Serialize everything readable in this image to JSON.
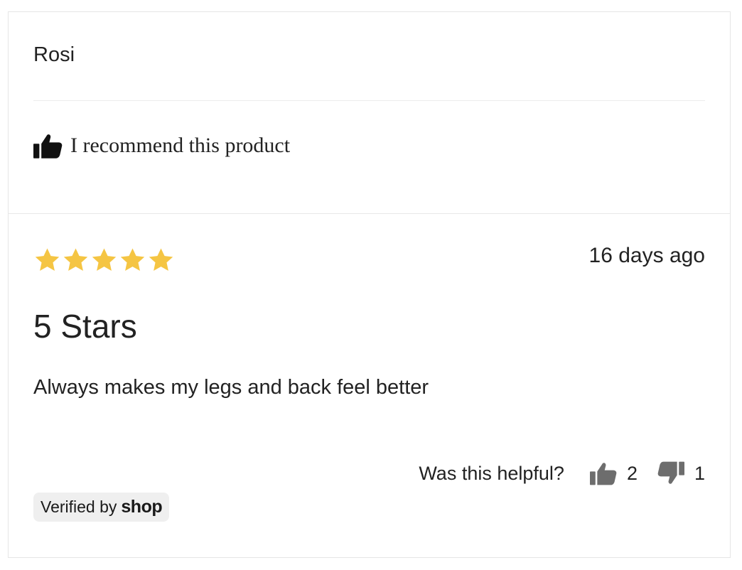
{
  "review": {
    "reviewer_name": "Rosi",
    "recommendation_text": "I recommend this product",
    "rating": 5,
    "rating_max": 5,
    "date": "16 days ago",
    "title": "5 Stars",
    "body": "Always makes my legs and back feel better"
  },
  "helpful": {
    "label": "Was this helpful?",
    "up_count": "2",
    "down_count": "1"
  },
  "badge": {
    "prefix": "Verified by",
    "brand": "shop"
  },
  "colors": {
    "star": "#f5c543",
    "icon_dark": "#111111",
    "icon_gray": "#6d6d6d",
    "text": "#222222"
  }
}
